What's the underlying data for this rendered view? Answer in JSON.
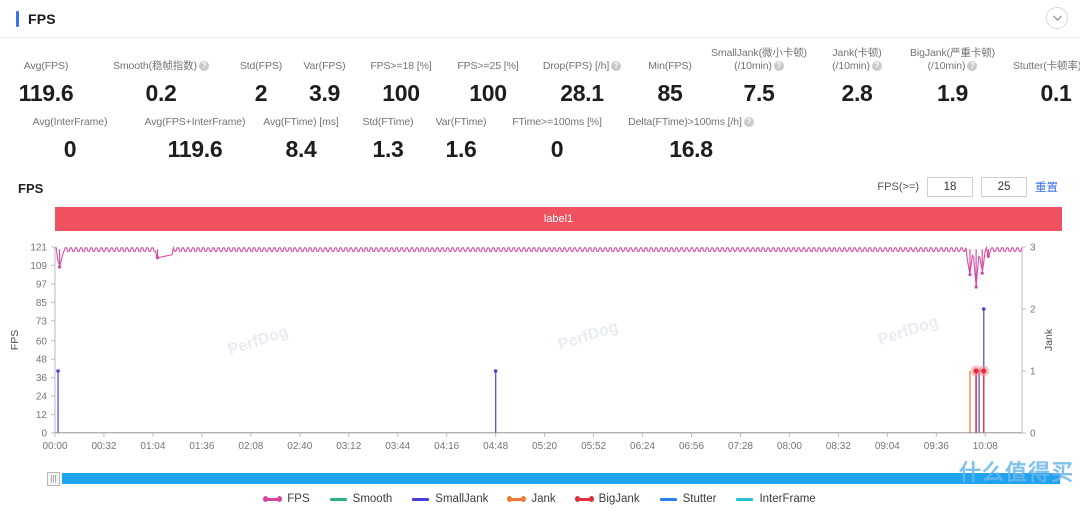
{
  "header": {
    "title": "FPS",
    "collapse_icon": "chevron-down-icon",
    "accent_color": "#3a72f0"
  },
  "metrics": {
    "row1": [
      {
        "label": "Avg(FPS)",
        "value": "119.6",
        "help": false
      },
      {
        "label": "Smooth(稳帧指数)",
        "value": "0.2",
        "help": true
      },
      {
        "label": "Std(FPS)",
        "value": "2",
        "help": false
      },
      {
        "label": "Var(FPS)",
        "value": "3.9",
        "help": false
      },
      {
        "label": "FPS>=18 [%]",
        "value": "100",
        "help": false
      },
      {
        "label": "FPS>=25 [%]",
        "value": "100",
        "help": false
      },
      {
        "label": "Drop(FPS) [/h]",
        "value": "28.1",
        "help": true
      },
      {
        "label": "Min(FPS)",
        "value": "85",
        "help": false
      },
      {
        "label": "SmallJank(微小卡顿)\n(/10min)",
        "value": "7.5",
        "help": true
      },
      {
        "label": "Jank(卡顿)\n(/10min)",
        "value": "2.8",
        "help": true
      },
      {
        "label": "BigJank(严重卡顿)\n(/10min)",
        "value": "1.9",
        "help": true
      },
      {
        "label": "Stutter(卡顿率) [%]",
        "value": "0.1",
        "help": false
      }
    ],
    "row2": [
      {
        "label": "Avg(InterFrame)",
        "value": "0",
        "help": false
      },
      {
        "label": "Avg(FPS+InterFrame)",
        "value": "119.6",
        "help": false
      },
      {
        "label": "Avg(FTime) [ms]",
        "value": "8.4",
        "help": false
      },
      {
        "label": "Std(FTime)",
        "value": "1.3",
        "help": false
      },
      {
        "label": "Var(FTime)",
        "value": "1.6",
        "help": false
      },
      {
        "label": "FTime>=100ms [%]",
        "value": "0",
        "help": false
      },
      {
        "label": "Delta(FTime)>100ms [/h]",
        "value": "16.8",
        "help": true
      }
    ],
    "help_badge_glyph": "?"
  },
  "chart_section": {
    "title": "FPS",
    "fps_gte_label": "FPS(>=)",
    "threshold_low": "18",
    "threshold_high": "25",
    "reset_label": "重置",
    "series_label_bar": "label1",
    "label_bar_color": "#ef5160"
  },
  "scrollbar": {
    "grip_icon": "drag-handle-icon",
    "grip_glyph": "|||",
    "track_color": "#1fa2f0"
  },
  "legend": [
    {
      "name": "FPS",
      "color": "#d6449f",
      "style": "dotted"
    },
    {
      "name": "Smooth",
      "color": "#2eb086",
      "style": "solid"
    },
    {
      "name": "SmallJank",
      "color": "#4b3fd4",
      "style": "solid"
    },
    {
      "name": "Jank",
      "color": "#ee7733",
      "style": "dotted"
    },
    {
      "name": "BigJank",
      "color": "#e0303b",
      "style": "dotted"
    },
    {
      "name": "Stutter",
      "color": "#2d7ff0",
      "style": "solid"
    },
    {
      "name": "InterFrame",
      "color": "#22c3d6",
      "style": "solid"
    }
  ],
  "watermarks": {
    "plot": "PerfDog",
    "site": "什么值得买"
  },
  "chart_data": {
    "type": "line",
    "title": "FPS",
    "xlabel": "",
    "ylabel": "FPS",
    "y2label": "Jank",
    "grid": false,
    "legend_position": "bottom",
    "ylim": [
      0,
      121
    ],
    "y2lim": [
      0,
      3
    ],
    "yticks": [
      0,
      12,
      24,
      36,
      48,
      60,
      73,
      85,
      97,
      109,
      121
    ],
    "y2ticks": [
      0,
      1,
      2,
      3
    ],
    "xticks": [
      "00:00",
      "00:32",
      "01:04",
      "01:36",
      "02:08",
      "02:40",
      "03:12",
      "03:44",
      "04:16",
      "04:48",
      "05:20",
      "05:52",
      "06:24",
      "06:56",
      "07:28",
      "08:00",
      "08:32",
      "09:04",
      "09:36",
      "10:08"
    ],
    "x_range_seconds": [
      0,
      632
    ],
    "series": [
      {
        "name": "FPS",
        "axis": "left",
        "color": "#d6449f",
        "note": "Flat near 119-120 fps for the whole run with small sawtooth ripple; brief dip to ~108 just after start, a dip to ~114 near 01:05, and a cluster of deeper dips (down to ~100, ~95) in the final 40 seconds near 10:08.",
        "points": [
          {
            "t": "00:00",
            "v": 120
          },
          {
            "t": "00:03",
            "v": 108
          },
          {
            "t": "00:06",
            "v": 120
          },
          {
            "t": "00:32",
            "v": 120
          },
          {
            "t": "01:04",
            "v": 119
          },
          {
            "t": "01:07",
            "v": 114
          },
          {
            "t": "01:36",
            "v": 120
          },
          {
            "t": "02:08",
            "v": 120
          },
          {
            "t": "02:40",
            "v": 120
          },
          {
            "t": "03:12",
            "v": 120
          },
          {
            "t": "03:44",
            "v": 120
          },
          {
            "t": "04:16",
            "v": 120
          },
          {
            "t": "04:48",
            "v": 117
          },
          {
            "t": "05:20",
            "v": 120
          },
          {
            "t": "05:52",
            "v": 120
          },
          {
            "t": "06:24",
            "v": 120
          },
          {
            "t": "06:56",
            "v": 120
          },
          {
            "t": "07:28",
            "v": 120
          },
          {
            "t": "08:00",
            "v": 120
          },
          {
            "t": "08:32",
            "v": 120
          },
          {
            "t": "09:04",
            "v": 120
          },
          {
            "t": "09:36",
            "v": 120
          },
          {
            "t": "09:55",
            "v": 120
          },
          {
            "t": "09:58",
            "v": 103
          },
          {
            "t": "10:00",
            "v": 119
          },
          {
            "t": "10:02",
            "v": 95
          },
          {
            "t": "10:04",
            "v": 118
          },
          {
            "t": "10:06",
            "v": 104
          },
          {
            "t": "10:08",
            "v": 119
          },
          {
            "t": "10:10",
            "v": 115
          },
          {
            "t": "10:12",
            "v": 120
          }
        ]
      },
      {
        "name": "Smooth",
        "axis": "left",
        "color": "#2eb086",
        "note": "Not plotted / flat at baseline.",
        "points": []
      },
      {
        "name": "SmallJank",
        "axis": "right",
        "color": "#4b3fd4",
        "note": "Impulse spikes at the jank events.",
        "points": [
          {
            "t": "00:02",
            "v": 1
          },
          {
            "t": "04:48",
            "v": 1
          },
          {
            "t": "10:02",
            "v": 1
          },
          {
            "t": "10:04",
            "v": 1
          },
          {
            "t": "10:07",
            "v": 2
          }
        ]
      },
      {
        "name": "Jank",
        "axis": "right",
        "color": "#ee7733",
        "note": "Impulse spikes to 1 at end of run.",
        "points": [
          {
            "t": "09:58",
            "v": 1
          },
          {
            "t": "10:02",
            "v": 1
          },
          {
            "t": "10:07",
            "v": 1
          }
        ]
      },
      {
        "name": "BigJank",
        "axis": "right",
        "color": "#e0303b",
        "note": "Two highlighted markers (pink halo) at value 1 near 10:02 and 10:07.",
        "points": [
          {
            "t": "10:02",
            "v": 1
          },
          {
            "t": "10:07",
            "v": 1
          }
        ]
      },
      {
        "name": "Stutter",
        "axis": "right",
        "color": "#2d7ff0",
        "note": "No visible excursions.",
        "points": []
      },
      {
        "name": "InterFrame",
        "axis": "right",
        "color": "#22c3d6",
        "note": "No visible excursions.",
        "points": []
      }
    ]
  }
}
